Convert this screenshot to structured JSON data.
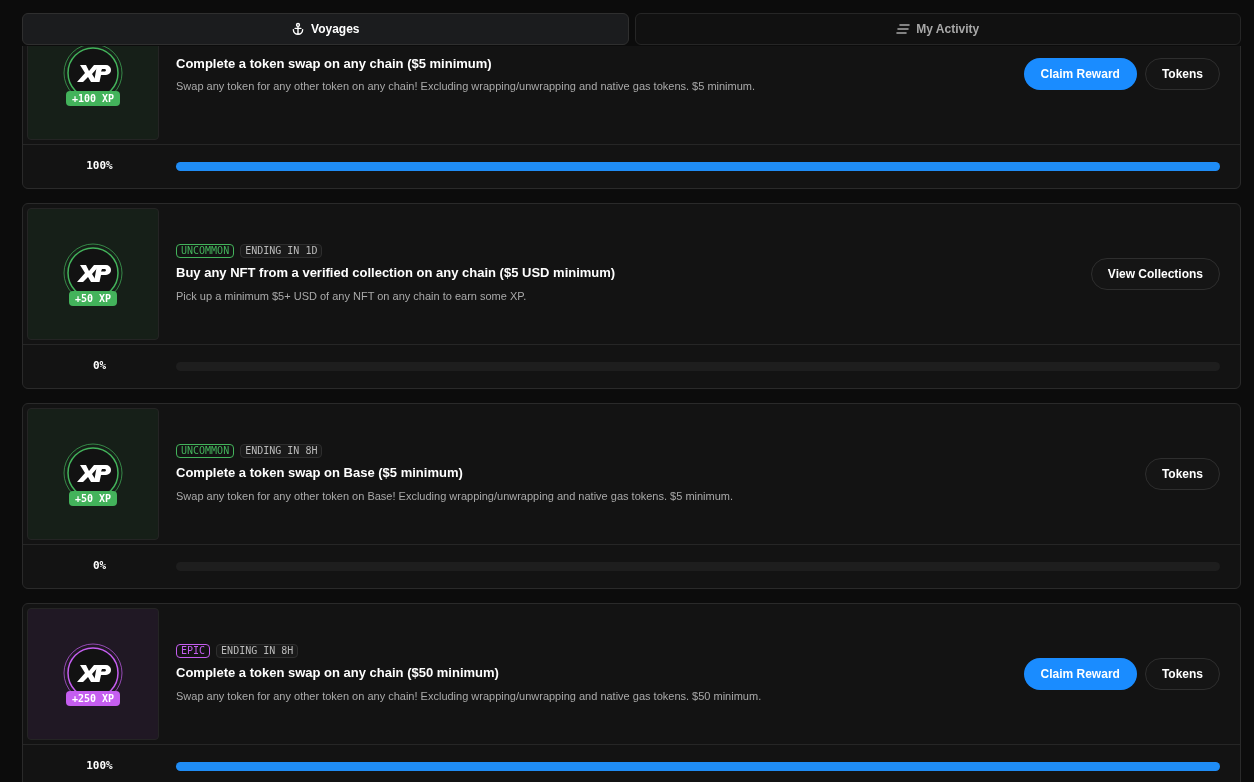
{
  "tabs": [
    {
      "label": "Voyages",
      "selected": true
    },
    {
      "label": "My Activity",
      "selected": false
    }
  ],
  "quests": [
    {
      "color": "#43b35b",
      "xp": "+100 XP",
      "title": "Complete a token swap on any chain ($5 minimum)",
      "description": "Swap any token for any other token on any chain! Excluding wrapping/unwrapping and native gas tokens. $5 minimum.",
      "buttons": [
        {
          "label": "Claim Reward",
          "kind": "primary"
        },
        {
          "label": "Tokens",
          "kind": "secondary"
        }
      ],
      "percent": "100%",
      "level": 1
    },
    {
      "color": "#43b35b",
      "xp": "+50 XP",
      "rarity": "UNCOMMON",
      "ending": "ENDING IN 1D",
      "title": "Buy any NFT from a verified collection on any chain ($5 USD minimum)",
      "description": "Pick up a minimum $5+ USD of any NFT on any chain to earn some XP.",
      "buttons": [
        {
          "label": "View Collections",
          "kind": "secondary"
        }
      ],
      "percent": "0%",
      "level": 0
    },
    {
      "color": "#43b35b",
      "xp": "+50 XP",
      "rarity": "UNCOMMON",
      "ending": "ENDING IN 8H",
      "title": "Complete a token swap on Base ($5 minimum)",
      "description": "Swap any token for any other token on Base! Excluding wrapping/unwrapping and native gas tokens. $5 minimum.",
      "buttons": [
        {
          "label": "Tokens",
          "kind": "secondary"
        }
      ],
      "percent": "0%",
      "level": 0
    },
    {
      "color": "#c55ef0",
      "xp": "+250 XP",
      "rarity": "EPIC",
      "ending": "ENDING IN 8H",
      "title": "Complete a token swap on any chain ($50 minimum)",
      "description": "Swap any token for any other token on any chain! Excluding wrapping/unwrapping and native gas tokens. $50 minimum.",
      "buttons": [
        {
          "label": "Claim Reward",
          "kind": "primary"
        },
        {
          "label": "Tokens",
          "kind": "secondary"
        }
      ],
      "percent": "100%",
      "level": 1
    }
  ]
}
